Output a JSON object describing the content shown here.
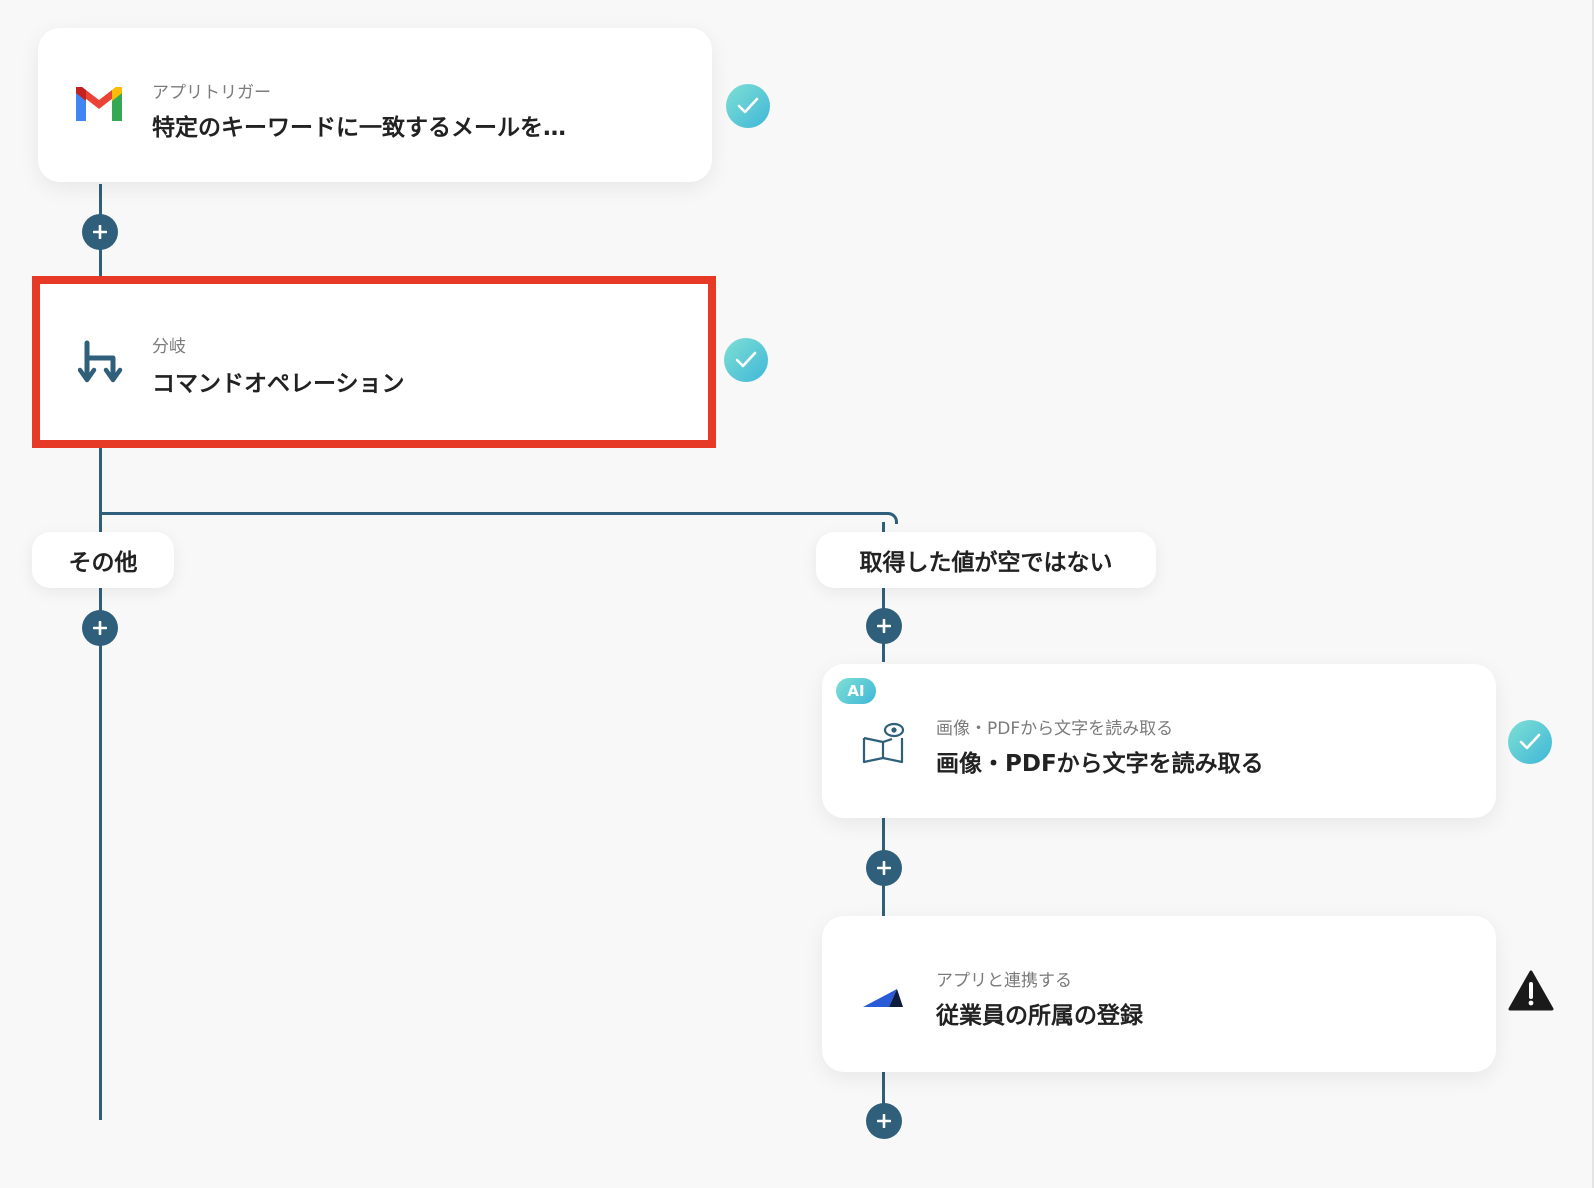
{
  "nodes": {
    "trigger": {
      "subtitle": "アプリトリガー",
      "title": "特定のキーワードに一致するメールを…",
      "icon": "gmail-icon",
      "status": "complete"
    },
    "branch": {
      "subtitle": "分岐",
      "title": "コマンドオペレーション",
      "icon": "branch-icon",
      "status": "complete",
      "highlighted": true
    },
    "ocr": {
      "badge": "AI",
      "subtitle": "画像・PDFから文字を読み取る",
      "title": "画像・PDFから文字を読み取る",
      "icon": "book-eye-icon",
      "status": "complete"
    },
    "register": {
      "subtitle": "アプリと連携する",
      "title": "従業員の所属の登録",
      "icon": "app-logo-icon",
      "status": "warning"
    }
  },
  "branches": {
    "other_label": "その他",
    "condition_label": "取得した値が空ではない"
  },
  "colors": {
    "line": "#2f5f7a",
    "highlight": "#e63a26",
    "check_start": "#7fe0d4",
    "check_end": "#3fb6d8",
    "background": "#f8f8f8"
  }
}
